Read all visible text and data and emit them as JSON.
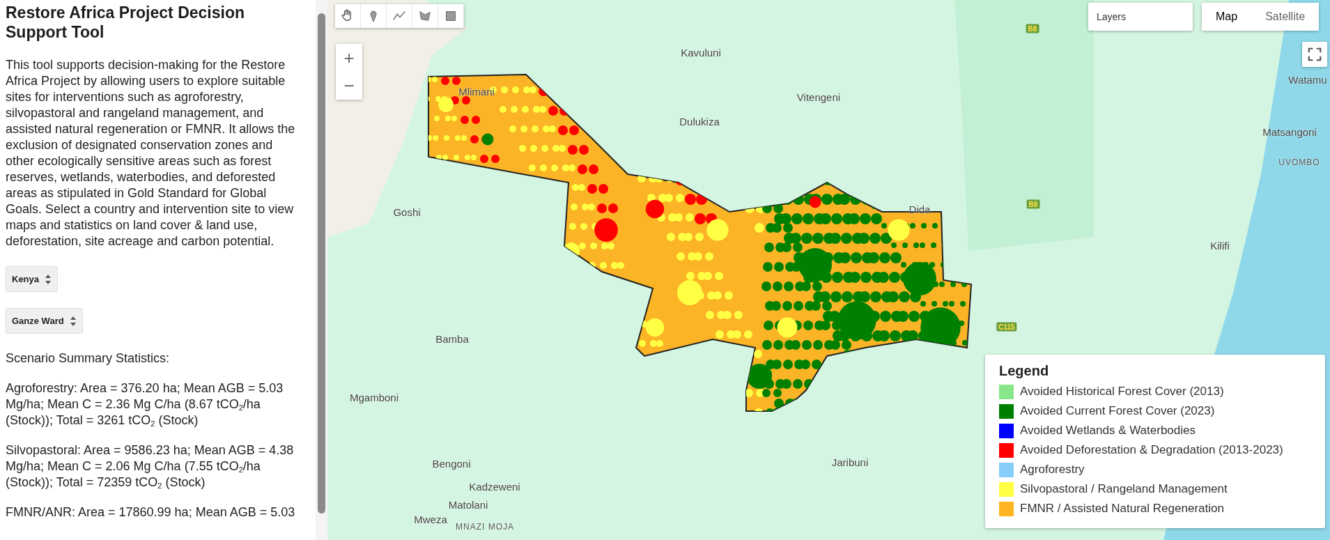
{
  "sidebar": {
    "title": "Restore Africa Project Decision Support Tool",
    "description": "This tool supports decision-making for the Restore Africa Project by allowing users to explore suitable sites for interventions such as agroforestry, silvopastoral and rangeland management, and assisted natural regeneration or FMNR. It allows the exclusion of designated conservation zones and other ecologically sensitive areas such as forest reserves, wetlands, waterbodies, and deforested areas as stipulated in Gold Standard for Global Goals. Select a country and intervention site to view maps and statistics on land cover & land use, deforestation, site acreage and carbon potential.",
    "selects": [
      {
        "value": "Kenya"
      },
      {
        "value": "Ganze Ward"
      }
    ],
    "stats_heading": "Scenario Summary Statistics:",
    "stats": [
      "Agroforestry: Area = 376.20 ha; Mean AGB = 5.03 Mg/ha; Mean C = 2.36 Mg C/ha (8.67 tCO$_{2}$/ha (Stock)); Total = 3261 tCO$_{2}$ (Stock)",
      "Silvopastoral: Area = 9586.23 ha; Mean AGB = 4.38 Mg/ha; Mean C = 2.06 Mg C/ha (7.55 tCO$_{2}$/ha (Stock)); Total = 72359 tCO$_{2}$ (Stock)",
      "FMNR/ANR: Area = 17860.99 ha; Mean AGB = 5.03"
    ]
  },
  "map": {
    "tools": [
      {
        "kind": "hand",
        "selected": false
      },
      {
        "kind": "point",
        "selected": false
      },
      {
        "kind": "line",
        "selected": false
      },
      {
        "kind": "polygon",
        "selected": false
      },
      {
        "kind": "rectangle",
        "selected": false
      }
    ],
    "zoom": [
      "+",
      "−"
    ],
    "layers": {
      "placeholder": "Layers"
    },
    "map_types": [
      {
        "label": "Map",
        "selected": true
      },
      {
        "label": "Satellite",
        "selected": false
      }
    ],
    "places": [
      {
        "name": "Kavuluni",
        "kind": "town"
      },
      {
        "name": "Mlimani",
        "kind": "town"
      },
      {
        "name": "Vitengeni",
        "kind": "town"
      },
      {
        "name": "Dulukiza",
        "kind": "town"
      },
      {
        "name": "Watamu",
        "kind": "town"
      },
      {
        "name": "Matsangoni",
        "kind": "town"
      },
      {
        "name": "UVOMBO",
        "kind": "area"
      },
      {
        "name": "Dida",
        "kind": "town"
      },
      {
        "name": "Goshi",
        "kind": "town"
      },
      {
        "name": "Kilifi",
        "kind": "town"
      },
      {
        "name": "Bamba",
        "kind": "town"
      },
      {
        "name": "Mgamboni",
        "kind": "town"
      },
      {
        "name": "Jaribuni",
        "kind": "town"
      },
      {
        "name": "Bengoni",
        "kind": "town"
      },
      {
        "name": "Kadzeweni",
        "kind": "town"
      },
      {
        "name": "Matolani",
        "kind": "town"
      },
      {
        "name": "Mweza",
        "kind": "town"
      },
      {
        "name": "MNAZI MOJA",
        "kind": "area"
      }
    ],
    "roads": [
      "B8",
      "B8",
      "C115"
    ],
    "legend": {
      "title": "Legend",
      "items": [
        {
          "label": "Avoided Historical Forest Cover (2013)",
          "color": "#88e788"
        },
        {
          "label": "Avoided Current Forest Cover (2023)",
          "color": "#008000"
        },
        {
          "label": "Avoided Wetlands & Waterbodies",
          "color": "#0000ff"
        },
        {
          "label": "Avoided Deforestation & Degradation (2013-2023)",
          "color": "#ff0000"
        },
        {
          "label": "Agroforestry",
          "color": "#87cefa"
        },
        {
          "label": "Silvopastoral / Rangeland Management",
          "color": "#ffff44"
        },
        {
          "label": "FMNR / Assisted Natural Regeneration",
          "color": "#ffb521"
        }
      ]
    }
  }
}
